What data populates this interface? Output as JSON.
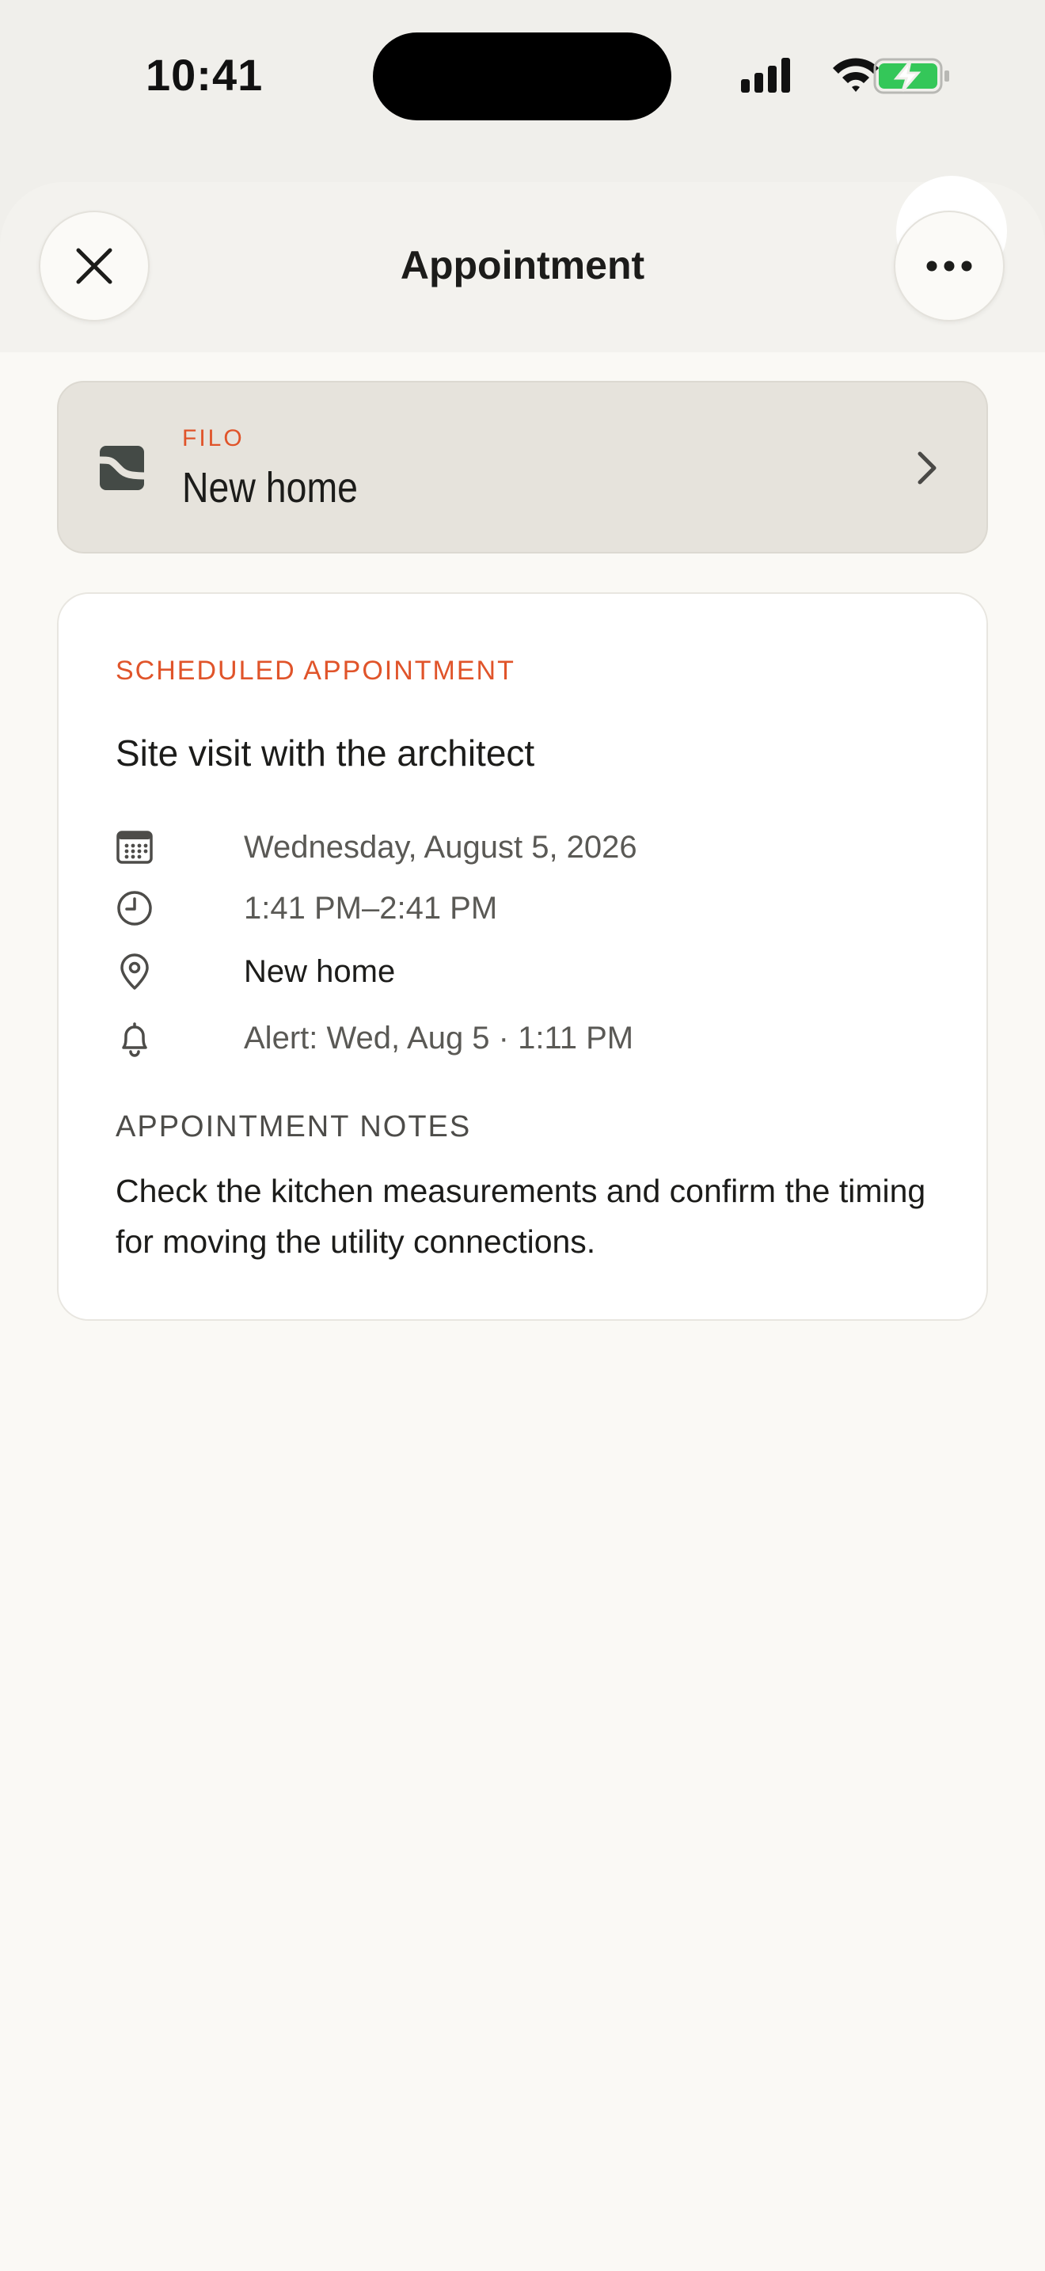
{
  "status_bar": {
    "time": "10:41"
  },
  "header": {
    "title": "Appointment",
    "close_icon": "close-icon",
    "more_icon": "more-horizontal-icon"
  },
  "project": {
    "kicker": "FILO",
    "name": "New home",
    "logo_icon": "filo-logo-icon",
    "chevron_icon": "chevron-right-icon"
  },
  "appointment": {
    "kicker": "SCHEDULED APPOINTMENT",
    "title": "Site visit with the architect",
    "date": "Wednesday, August 5, 2026",
    "time": "1:41 PM–2:41 PM",
    "location": "New home",
    "alert": "Alert: Wed, Aug 5 · 1:11 PM",
    "notes_heading": "APPOINTMENT NOTES",
    "notes": "Check the kitchen measurements and confirm the timing for moving the utility connections."
  },
  "colors": {
    "accent": "#e0542a",
    "background": "#faf9f5",
    "project_card": "#e6e3dc",
    "battery": "#34c759"
  }
}
